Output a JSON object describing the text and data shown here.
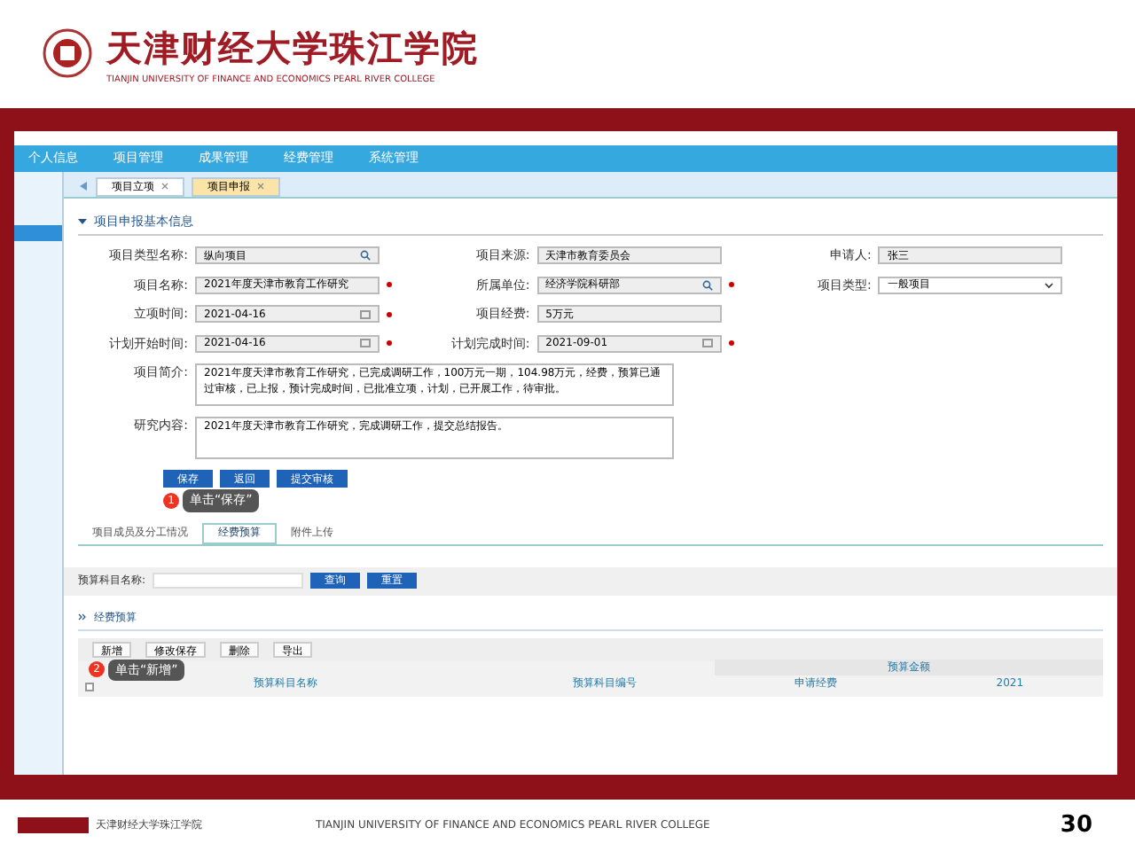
{
  "slide": {
    "school_name": "天津财经大学珠江学院",
    "school_name_en": "TIANJIN UNIVERSITY OF FINANCE AND ECONOMICS PEARL RIVER COLLEGE",
    "footer_name": "天津财经大学珠江学院",
    "footer_en": "TIANJIN UNIVERSITY OF FINANCE AND ECONOMICS PEARL RIVER COLLEGE",
    "page_number": "30"
  },
  "nav": [
    {
      "label": "个人信息",
      "selected": false
    },
    {
      "label": "项目管理",
      "selected": false
    },
    {
      "label": "成果管理",
      "selected": false
    },
    {
      "label": "经费管理",
      "selected": false
    },
    {
      "label": "系统管理",
      "selected": false
    }
  ],
  "tabs": [
    {
      "label": "项目立项",
      "selected": false
    },
    {
      "label": "项目申报",
      "selected": true
    }
  ],
  "section_title": "项目申报基本信息",
  "form_rows": [
    [
      {
        "label": "项目类型名称:",
        "value": "纵向项目",
        "kind": "lookup",
        "required": false
      },
      {
        "label": "项目来源:",
        "value": "天津市教育委员会",
        "kind": "text",
        "required": false
      },
      {
        "label": "申请人:",
        "value": "张三",
        "kind": "text",
        "required": false
      }
    ],
    [
      {
        "label": "项目名称:",
        "value": "2021年度天津市教育工作研究",
        "kind": "text",
        "required": true
      },
      {
        "label": "所属单位:",
        "value": "经济学院科研部",
        "kind": "lookup",
        "required": true
      },
      {
        "label": "项目类型:",
        "value": "一般项目",
        "kind": "select",
        "required": false
      }
    ],
    [
      {
        "label": "立项时间:",
        "value": "2021-04-16",
        "kind": "date",
        "required": true
      },
      {
        "label": "项目经费:",
        "value": "5万元",
        "kind": "text",
        "required": false
      }
    ],
    [
      {
        "label": "计划开始时间:",
        "value": "2021-04-16",
        "kind": "date",
        "required": true
      },
      {
        "label": "计划完成时间:",
        "value": "2021-09-01",
        "kind": "date",
        "required": true
      }
    ]
  ],
  "textareas": [
    {
      "label": "项目简介:",
      "value": "2021年度天津市教育工作研究，已完成调研工作，100万元一期，104.98万元，经费，预算已通过审核，已上报，预计完成时间，已批准立项，计划，已开展工作，待审批。"
    },
    {
      "label": "研究内容:",
      "value": "2021年度天津市教育工作研究，完成调研工作，提交总结报告。"
    }
  ],
  "form_buttons": [
    "保存",
    "返回",
    "提交审核"
  ],
  "hint_1": {
    "number": "1",
    "text": "单击“保存”"
  },
  "sub_tabs": [
    {
      "label": "项目成员及分工情况",
      "selected": false
    },
    {
      "label": "经费预算",
      "selected": true
    },
    {
      "label": "附件上传",
      "selected": false
    }
  ],
  "search": {
    "label": "预算科目名称:",
    "buttons": [
      "查询",
      "重置"
    ]
  },
  "budget_title": "经费预算",
  "toolbar": [
    "新增",
    "修改保存",
    "删除",
    "导出"
  ],
  "hint_2": {
    "number": "2",
    "text": "单击“新增”"
  },
  "table": {
    "select_all_checked": false,
    "columns": [
      "预算科目名称",
      "预算科目编号"
    ],
    "group": "预算金额",
    "sub_columns": [
      "申请经费",
      "2021"
    ]
  }
}
